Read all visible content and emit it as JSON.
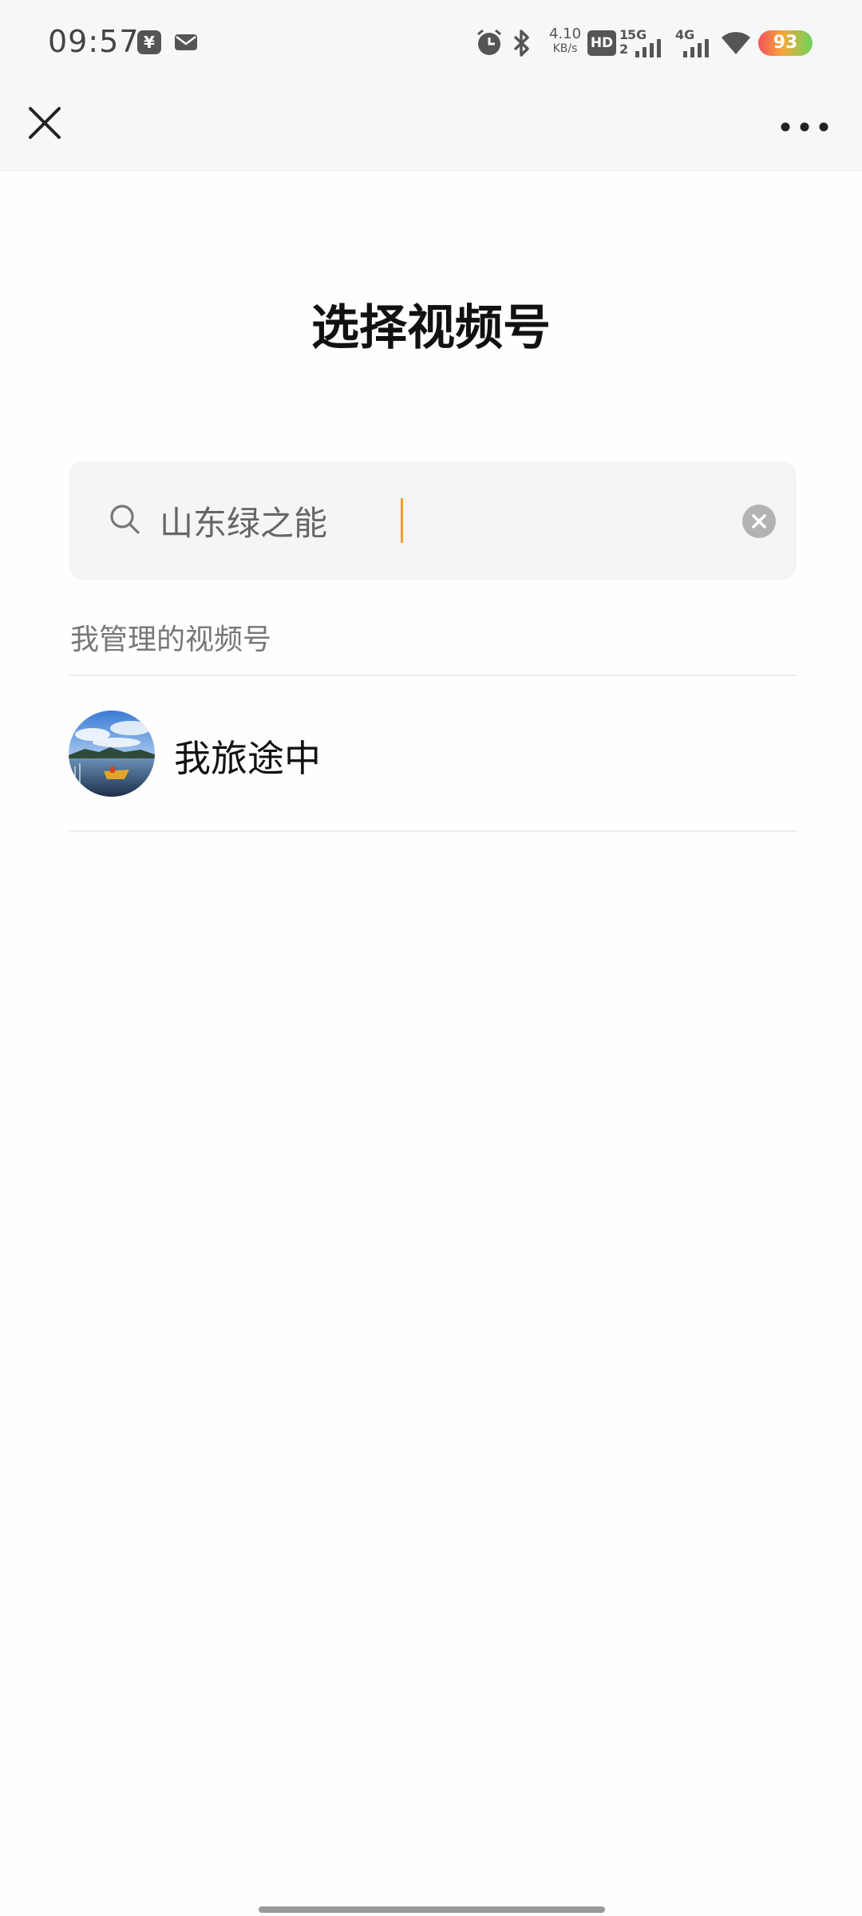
{
  "status_bar": {
    "time": "09:57",
    "notification_icons": [
      "yuan-app-icon",
      "mail-icon"
    ],
    "net_speed_value": "4.10",
    "net_speed_unit": "KB/s",
    "hd_label": "HD",
    "sim1_label": "1",
    "sim2_label": "2",
    "net1": "5G",
    "net2": "4G",
    "battery": "93",
    "icons": [
      "alarm-icon",
      "bluetooth-icon",
      "hd-icon",
      "signal-5g-icon",
      "signal-4g-icon",
      "wifi-icon",
      "battery-icon"
    ]
  },
  "top_bar": {
    "close_icon": "close-icon",
    "more_icon": "more-dots-icon"
  },
  "title": "选择视频号",
  "search": {
    "value": "山东绿之能",
    "icon": "search-icon",
    "clear_icon": "clear-icon"
  },
  "section": {
    "label": "我管理的视频号",
    "items": [
      {
        "name": "我旅途中",
        "avatar": "lake-landscape-avatar"
      }
    ]
  },
  "colors": {
    "caret": "#f0a020",
    "battery_start": "#f2545b",
    "battery_end": "#6bd65b"
  }
}
